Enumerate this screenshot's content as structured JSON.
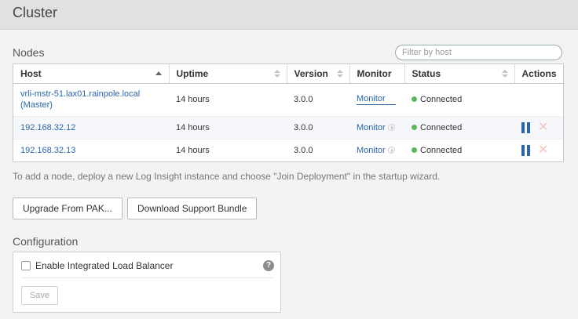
{
  "page": {
    "title": "Cluster"
  },
  "nodes": {
    "title": "Nodes",
    "filter_placeholder": "Filter by host",
    "columns": [
      "Host",
      "Uptime",
      "Version",
      "Monitor",
      "Status",
      "Actions"
    ],
    "rows": [
      {
        "host": "vrli-mstr-51.lax01.rainpole.local (Master)",
        "uptime": "14 hours",
        "version": "3.0.0",
        "monitor": "Monitor",
        "status": "Connected",
        "status_color": "#5cb85c"
      },
      {
        "host": "192.168.32.12",
        "uptime": "14 hours",
        "version": "3.0.0",
        "monitor": "Monitor",
        "status": "Connected",
        "status_color": "#5cb85c"
      },
      {
        "host": "192.168.32.13",
        "uptime": "14 hours",
        "version": "3.0.0",
        "monitor": "Monitor",
        "status": "Connected",
        "status_color": "#5cb85c"
      }
    ],
    "hint": "To add a node, deploy a new Log Insight instance and choose \"Join Deployment\" in the startup wizard."
  },
  "buttons": {
    "upgrade": "Upgrade From PAK...",
    "download": "Download Support Bundle"
  },
  "configuration": {
    "title": "Configuration",
    "load_balancer_label": "Enable Integrated Load Balancer",
    "help_symbol": "?",
    "save": "Save"
  },
  "colors": {
    "link": "#2b66a8",
    "status_ok": "#5cb85c",
    "header_bg": "#e3e0e3"
  }
}
